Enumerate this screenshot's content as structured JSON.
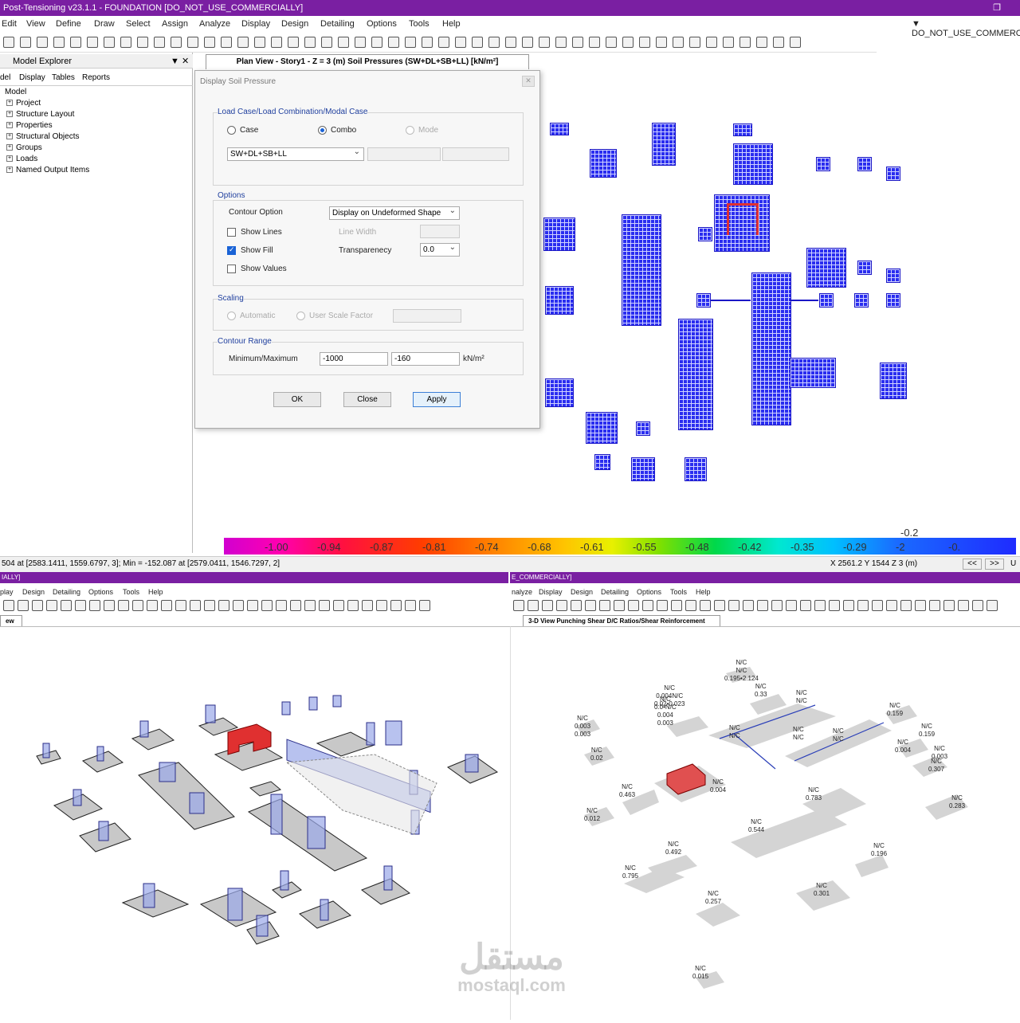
{
  "app": {
    "title": "Post-Tensioning v23.1.1 - FOUNDATION  [DO_NOT_USE_COMMERCIALLY]",
    "right_label": "▼ DO_NOT_USE_COMMERCI"
  },
  "menu": [
    "Edit",
    "View",
    "Define",
    "Draw",
    "Select",
    "Assign",
    "Analyze",
    "Display",
    "Design",
    "Detailing",
    "Options",
    "Tools",
    "Help"
  ],
  "explorer": {
    "title": "Model Explorer",
    "tabs": [
      "del",
      "Display",
      "Tables",
      "Reports"
    ],
    "root": "Model",
    "items": [
      "Project",
      "Structure Layout",
      "Properties",
      "Structural Objects",
      "Groups",
      "Loads",
      "Named Output Items"
    ]
  },
  "plan_view": {
    "tab": "Plan View - Story1 - Z = 3 (m)    Soil Pressures    (SW+DL+SB+LL)  [kN/m²]"
  },
  "dialog": {
    "title": "Display Soil Pressure",
    "close": "✕",
    "load_group": "Load Case/Load Combination/Modal Case",
    "case_label": "Case",
    "combo_label": "Combo",
    "mode_label": "Mode",
    "combo_value": "SW+DL+SB+LL",
    "options_group": "Options",
    "contour_option_label": "Contour Option",
    "contour_option_value": "Display on Undeformed Shape",
    "show_lines": "Show Lines",
    "line_width": "Line Width",
    "show_fill": "Show Fill",
    "transparency_label": "Transparenecy",
    "transparency_value": "0.0",
    "show_values": "Show Values",
    "scaling_group": "Scaling",
    "automatic": "Automatic",
    "user_scale": "User Scale Factor",
    "range_group": "Contour Range",
    "minmax_label": "Minimum/Maximum",
    "min_value": "-1000",
    "max_value": "-160",
    "unit": "kN/m²",
    "ok": "OK",
    "close_btn": "Close",
    "apply": "Apply"
  },
  "colorbar": {
    "top_label": "-0.2",
    "labels": [
      "-1.00",
      "-0.94",
      "-0.87",
      "-0.81",
      "-0.74",
      "-0.68",
      "-0.61",
      "-0.55",
      "-0.48",
      "-0.42",
      "-0.35",
      "-0.29",
      "-2",
      "-0."
    ]
  },
  "status": {
    "left": "504 at [2583.1411, 1559.6797, 3];  Min = -152.087 at [2579.0411, 1546.7297, 2]",
    "coords": "X 2561.2  Y 1544  Z 3 (m)",
    "prev": "<<",
    "next": ">>",
    "unit": "U"
  },
  "pane_left": {
    "title": "IALLY]",
    "menu": [
      "play",
      "Design",
      "Detailing",
      "Options",
      "Tools",
      "Help"
    ],
    "tab": "ew"
  },
  "pane_right": {
    "title": "E_COMMERCIALLY]",
    "menu": [
      "nalyze",
      "Display",
      "Design",
      "Detailing",
      "Options",
      "Tools",
      "Help"
    ],
    "tab": "3-D View  Punching Shear D/C Ratios/Shear Reinforcement"
  },
  "dc_ratios": [
    {
      "t": "N/C\nN/C\n0.195•2.124"
    },
    {
      "t": "N/C\n0.33"
    },
    {
      "t": "N/C\n0.004N/C\n0.02•0.023"
    },
    {
      "t": "N/C\n0.0•N/C\n0.004\n0.003"
    },
    {
      "t": "N/C\nN/C"
    },
    {
      "t": "N/C\nN/C"
    },
    {
      "t": "N/C\n0.159"
    },
    {
      "t": "N/C\n0.003\n0.003"
    },
    {
      "t": "N/C\n0.02"
    },
    {
      "t": "N/C\nN/C"
    },
    {
      "t": "N/C\nN/C"
    },
    {
      "t": "N/C\n0.159"
    },
    {
      "t": "N/C\n0.004"
    },
    {
      "t": "N/C\n0.003"
    },
    {
      "t": "N/C\n0.307"
    },
    {
      "t": "N/C\n0.463"
    },
    {
      "t": "N/C\n0.004"
    },
    {
      "t": "N/C\n0.783"
    },
    {
      "t": "N/C\n0.283"
    },
    {
      "t": "N/C\n0.012"
    },
    {
      "t": "N/C\n0.544"
    },
    {
      "t": "N/C\n0.492"
    },
    {
      "t": "N/C\n0.196"
    },
    {
      "t": "N/C\n0.795"
    },
    {
      "t": "N/C\n0.257"
    },
    {
      "t": "N/C\n0.301"
    },
    {
      "t": "N/C\n0.015"
    }
  ],
  "watermark": {
    "arabic": "مستقل",
    "latin": "mostaql.com"
  },
  "colors": {
    "title": "#7a1fa2",
    "footing_fill": "#2a2df0",
    "highlight": "#e03030"
  }
}
